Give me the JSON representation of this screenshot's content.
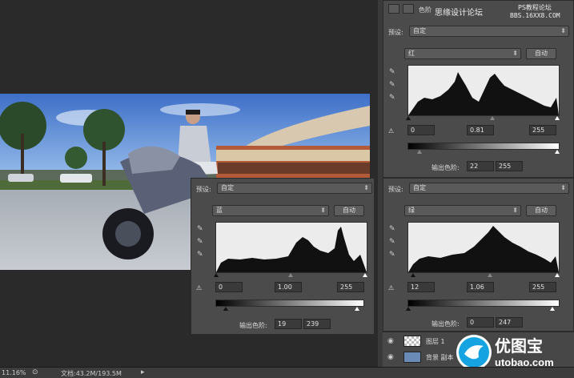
{
  "top_panel": {
    "tab_label": "色阶",
    "watermark_line1": "思缘设计论坛",
    "watermark_line2": "PS教程论坛",
    "watermark_line3": "BBS.16XX8.COM",
    "preset_label": "预设:",
    "preset_value": "自定",
    "channel_value": "红",
    "auto_button": "自动",
    "input_black": "0",
    "input_gamma": "0.81",
    "input_white": "255",
    "output_label": "输出色阶:",
    "output_black": "22",
    "output_white": "255"
  },
  "mid_panel": {
    "preset_label": "预设:",
    "preset_value": "自定",
    "channel_value": "蓝",
    "auto_button": "自动",
    "input_black": "0",
    "input_gamma": "1.00",
    "input_white": "255",
    "output_label": "输出色阶:",
    "output_black": "19",
    "output_white": "239"
  },
  "right_panel": {
    "preset_label": "预设:",
    "preset_value": "自定",
    "channel_value": "绿",
    "auto_button": "自动",
    "input_black": "12",
    "input_gamma": "1.06",
    "input_white": "255",
    "output_label": "输出色阶:",
    "output_black": "0",
    "output_white": "247"
  },
  "layers": {
    "layer1": "图层 1",
    "layer2": "背景 副本"
  },
  "status": {
    "zoom": "11.16%",
    "doc": "文档:43.2M/193.5M"
  },
  "logo": {
    "name": "优图宝",
    "url": "utobao.com"
  },
  "colors": {
    "panel": "#4b4b4b",
    "canvas": "#262626"
  }
}
